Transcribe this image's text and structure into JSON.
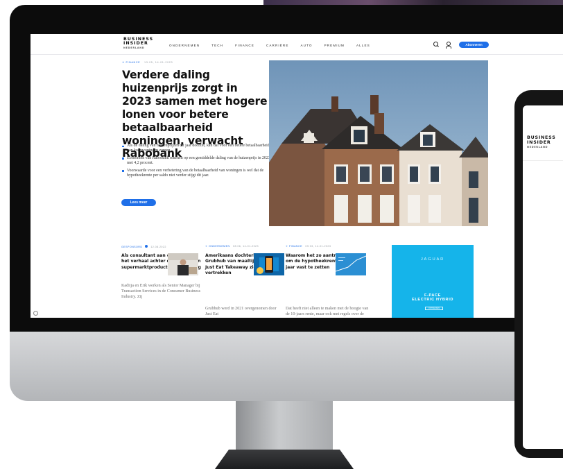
{
  "site": {
    "logo": [
      "BUSINESS",
      "INSIDER",
      "NEDERLAND"
    ],
    "nav": [
      "ONDERNEMEN",
      "TECH",
      "FINANCE",
      "CARRIÈRE",
      "AUTO",
      "PREMIUM",
      "ALLES"
    ],
    "subscribe_label": "Abonneren",
    "accent_color": "#1f6fe8"
  },
  "hero": {
    "kicker": "FINANCE",
    "date": "13:05, 14-01-2023",
    "title": "Verdere daling huizenprijs zorgt in 2023 samen met hogere lonen voor betere betaalbaarheid woningen, verwacht Rabobank",
    "bullets": [
      "Als de daling van huizenprijzen dit jaar doorzet, kan dat voor een betere betaalbaarheid van koopwoningen zorgen.",
      "Economen van Rabobank rekenen op een gemiddelde daling van de huizenprijs in 2023 met 4,2 procent.",
      "Voorwaarde voor een verbetering van de betaalbaarheid van woningen is wel dat de hypotheekrente per saldo niet verder stijgt dit jaar."
    ],
    "read_more": "Lees meer"
  },
  "cards": [
    {
      "tag": "GESPONSORD",
      "date": "12.08.2022",
      "title": "Als consultant aan de slag met het verhaal achter de cijfers: van supermarktproducten tot kleding",
      "body": "Kadiija en Erik werken als Senior Manager bij Transaction Services in de Consumer Business Industry. Zij"
    },
    {
      "tag": "ONDERNEMEN",
      "date": "08:06, 14-01-2023",
      "title": "Amerikaans dochterbedrijf Grubhub van maaltijdbezorger Just Eat Takeaway ziet CEO vertrekken",
      "body": "Grubhub werd in 2021 overgenomen door Just Eat"
    },
    {
      "tag": "FINANCE",
      "date": "09:03, 14-01-2023",
      "title": "Waarom het zo aantrekkelijk is om de hypotheekrente voor 10 jaar vast te zetten",
      "body": "Dat heeft niet alleen te maken met de hoogte van de 10-jaars rente, maar ook met regels over de"
    }
  ],
  "ad": {
    "brand": "JAGUAR",
    "model": [
      "F-PACE",
      "ELECTRIC HYBRID"
    ],
    "cta": "ONTDEKKEN",
    "color": "#15b4ea"
  },
  "tablet": {
    "logo": [
      "BUSINESS",
      "INSIDER",
      "NEDERLAND"
    ]
  }
}
